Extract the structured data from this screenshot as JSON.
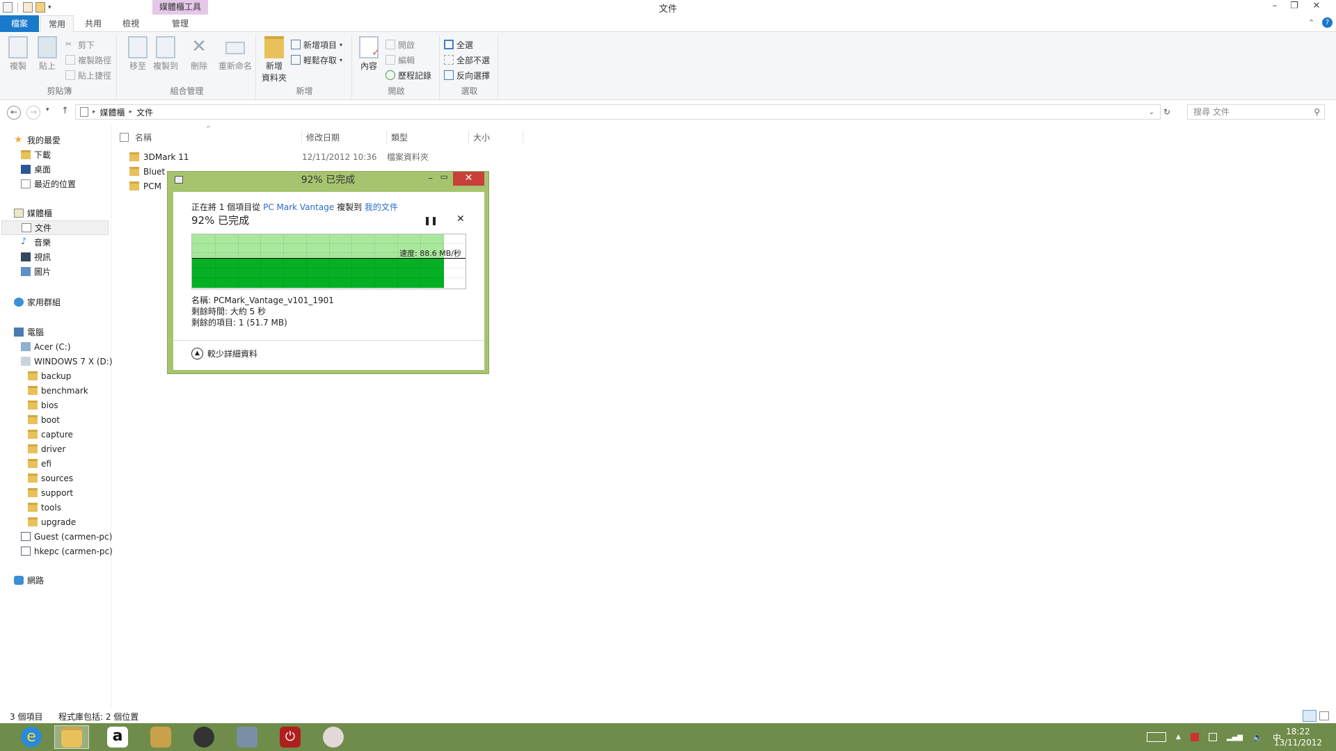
{
  "window": {
    "title": "文件",
    "context_tool": "媒體櫃工具"
  },
  "tabs": {
    "file": "檔案",
    "home": "常用",
    "share": "共用",
    "view": "檢視",
    "manage": "管理"
  },
  "ribbon": {
    "clipboard": {
      "copy": "複製",
      "paste": "貼上",
      "cut": "剪下",
      "copy_path": "複製路徑",
      "paste_shortcut": "貼上捷徑",
      "label": "剪貼簿"
    },
    "organize": {
      "move_to": "移至",
      "copy_to": "複製到",
      "delete": "刪除",
      "rename": "重新命名",
      "label": "組合管理"
    },
    "new": {
      "new_folder_line1": "新增",
      "new_folder_line2": "資料夾",
      "new_item": "新增項目",
      "easy_access": "輕鬆存取",
      "label": "新增"
    },
    "open": {
      "properties": "內容",
      "open": "開啟",
      "edit": "編輯",
      "history": "歷程記錄",
      "label": "開啟"
    },
    "select": {
      "select_all": "全選",
      "select_none": "全部不選",
      "invert": "反向選擇",
      "label": "選取"
    }
  },
  "address": {
    "crumb1": "媒體櫃",
    "crumb2": "文件",
    "search_placeholder": "搜尋 文件"
  },
  "nav": {
    "favorites": "我的最愛",
    "downloads": "下載",
    "desktop": "桌面",
    "recent": "最近的位置",
    "libraries": "媒體櫃",
    "documents": "文件",
    "music": "音樂",
    "videos": "視訊",
    "pictures": "圖片",
    "homegroup": "家用群組",
    "computer": "電腦",
    "acer": "Acer (C:)",
    "win7": "WINDOWS 7 X (D:)",
    "subfolders": [
      "backup",
      "benchmark",
      "bios",
      "boot",
      "capture",
      "driver",
      "efi",
      "sources",
      "support",
      "tools",
      "upgrade"
    ],
    "guest": "Guest (carmen-pc)",
    "hkepc": "hkepc (carmen-pc)",
    "network": "網路"
  },
  "columns": {
    "name": "名稱",
    "modified": "修改日期",
    "type": "類型",
    "size": "大小"
  },
  "files": [
    {
      "name": "3DMark 11",
      "date": "12/11/2012 10:36",
      "type": "檔案資料夾"
    },
    {
      "name": "Bluet",
      "date": "",
      "type": ""
    },
    {
      "name": "PCM",
      "date": "",
      "type": ""
    }
  ],
  "status": {
    "count": "3 個項目",
    "library_info": "程式庫包括: 2 個位置"
  },
  "dialog": {
    "title": "92% 已完成",
    "line_prefix": "正在將 1 個項目從",
    "source": "PC Mark Vantage",
    "line_mid": "複製到",
    "dest": "我的文件",
    "percent_text": "92% 已完成",
    "progress": 0.92,
    "speed": "速度: 88.6 MB/秒",
    "name_line": "名稱: PCMark_Vantage_v101_1901",
    "time_line": "剩餘時間: 大約 5 秒",
    "items_line": "剩餘的項目: 1 (51.7 MB)",
    "less_details": "較少詳細資料",
    "pause_icon": "pause-icon",
    "stop_icon": "close-icon"
  },
  "taskbar": {
    "ime": "中",
    "time": "18:22",
    "date": "13/11/2012"
  },
  "colors": {
    "accent": "#1979ca",
    "taskbar": "#6f8c4a",
    "dialog_frame": "#a6c46e",
    "progress": "#06b025"
  }
}
